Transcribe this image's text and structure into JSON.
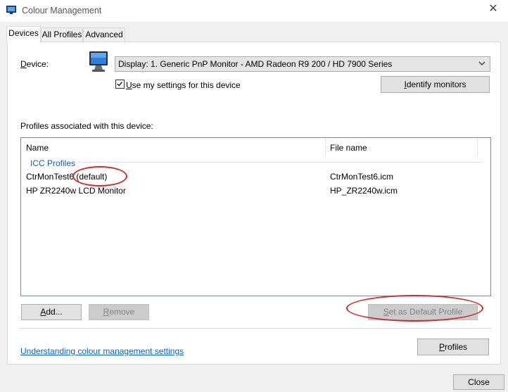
{
  "window": {
    "title": "Colour Management",
    "close_glyph": "✕"
  },
  "tabs": [
    {
      "label": "Devices",
      "active": true
    },
    {
      "label": "All Profiles",
      "active": false
    },
    {
      "label": "Advanced",
      "active": false
    }
  ],
  "device": {
    "label_underlined": "D",
    "label_rest": "evice:",
    "selected": "Display: 1. Generic PnP Monitor - AMD Radeon R9 200 / HD 7900 Series",
    "use_settings_underlined": "U",
    "use_settings_rest": "se my settings for this device",
    "use_settings_checked": true,
    "identify_underlined": "I",
    "identify_rest": "dentify monitors"
  },
  "profiles": {
    "section_label": "Profiles associated with this device:",
    "columns": [
      "Name",
      "File name"
    ],
    "group": "ICC Profiles",
    "rows": [
      {
        "name": "CtrMonTest6 (default)",
        "file": "CtrMonTest6.icm"
      },
      {
        "name": "HP ZR2240w LCD Monitor",
        "file": "HP_ZR2240w.icm"
      }
    ]
  },
  "buttons": {
    "add_underlined": "A",
    "add_rest": "dd...",
    "remove_underlined": "R",
    "remove_rest": "emove",
    "set_default_underlined": "S",
    "set_default_rest": "et as Default Profile",
    "profiles_underlined": "P",
    "profiles_prefix": "",
    "profiles_rest": "rofiles",
    "close": "Close"
  },
  "footer": {
    "link_text": "Understanding colour management settings"
  },
  "colors": {
    "accent_link": "#0066cc",
    "group_label": "#1e5ab4",
    "annotation_red": "#d42a2a"
  },
  "icons": [
    "app-icon",
    "monitor-icon",
    "close-icon",
    "chevron-down-icon",
    "checkmark-icon"
  ]
}
